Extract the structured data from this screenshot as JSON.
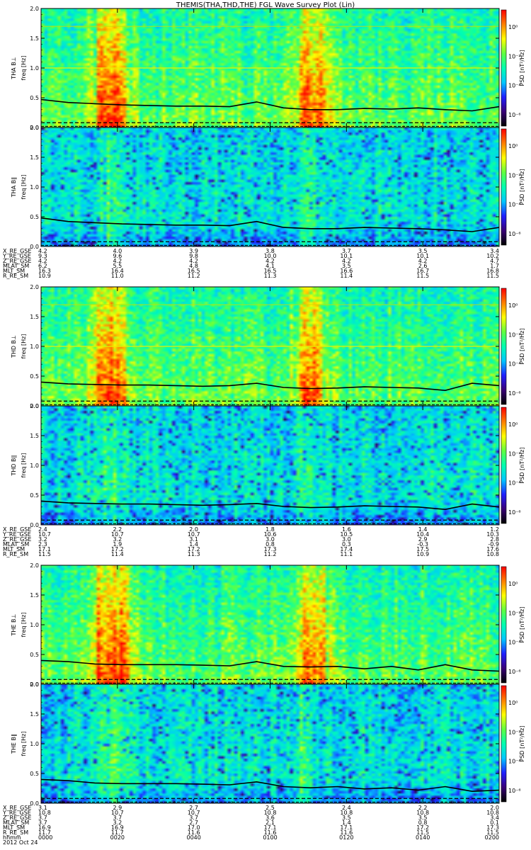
{
  "chart_data": {
    "type": "heatmap",
    "title": "THEMIS(THA,THD,THE) FGL Wave Survey Plot (Lin)",
    "frequency_range": [
      0,
      2.0
    ],
    "yticks": [
      "2.0",
      "1.5",
      "1.0",
      "0.5",
      "0.0"
    ],
    "colorbar_label": "PSD [nT²/Hz]",
    "colorbar_ticks": [
      "10⁰",
      "10⁻²",
      "10⁻⁴",
      "10⁻⁶"
    ],
    "colorscale": [
      "#000000",
      "#3a0078",
      "#2020ff",
      "#00c8ff",
      "#00ffb0",
      "#60ff40",
      "#ffff00",
      "#ff8000",
      "#ff0000"
    ],
    "panels": [
      {
        "probe": "THA",
        "sub": [
          {
            "label": "THA B⊥",
            "ylabel": "freq [Hz]",
            "kind": "perp",
            "vbands": [
              [
                0.12,
                0.18,
                0.95
              ],
              [
                0.56,
                0.62,
                0.95
              ]
            ],
            "hline": 1.0,
            "hline2": 1.7,
            "line": [
              0.47,
              0.42,
              0.4,
              0.38,
              0.37,
              0.36,
              0.36,
              0.35,
              0.43,
              0.33,
              0.3,
              0.3,
              0.32,
              0.31,
              0.33,
              0.3,
              0.28,
              0.35
            ]
          },
          {
            "label": "THA B∥",
            "ylabel": "freq [Hz]",
            "kind": "par",
            "vbands": [
              [
                0.14,
                0.17,
                0.55
              ],
              [
                0.56,
                0.58,
                0.5
              ]
            ],
            "line": [
              0.48,
              0.42,
              0.4,
              0.38,
              0.37,
              0.36,
              0.36,
              0.35,
              0.42,
              0.32,
              0.3,
              0.3,
              0.32,
              0.31,
              0.3,
              0.28,
              0.25,
              0.32
            ]
          }
        ],
        "ephem_labels": [
          "X_RE_GSE",
          "Y_RE_GSE",
          "Z_RE_GSE",
          "MLAT_SM",
          "MLT_SM",
          "R_RE_SM"
        ],
        "ephem": [
          [
            "4.2",
            "4.0",
            "3.9",
            "3.8",
            "3.7",
            "3.5",
            "3.4"
          ],
          [
            "9.3",
            "9.6",
            "9.8",
            "10.0",
            "10.1",
            "10.1",
            "10.2"
          ],
          [
            "4.2",
            "4.2",
            "4.2",
            "4.2",
            "4.2",
            "4.2",
            "4.7"
          ],
          [
            "6.2",
            "5.5",
            "4.8",
            "4.1",
            "3.5",
            "2.6",
            "1.7"
          ],
          [
            "16.3",
            "16.4",
            "16.5",
            "16.5",
            "16.6",
            "16.7",
            "16.8"
          ],
          [
            "10.9",
            "11.0",
            "11.2",
            "11.3",
            "11.4",
            "11.5",
            "11.5"
          ]
        ]
      },
      {
        "probe": "THD",
        "sub": [
          {
            "label": "THD B⊥",
            "ylabel": "freq [Hz]",
            "kind": "perp",
            "vbands": [
              [
                0.12,
                0.18,
                0.95
              ],
              [
                0.56,
                0.61,
                0.85
              ]
            ],
            "hline": 1.0,
            "hline2": 1.7,
            "line": [
              0.4,
              0.37,
              0.36,
              0.35,
              0.35,
              0.34,
              0.33,
              0.34,
              0.38,
              0.31,
              0.29,
              0.3,
              0.32,
              0.31,
              0.3,
              0.26,
              0.38,
              0.34
            ]
          },
          {
            "label": "THD B∥",
            "ylabel": "freq [Hz]",
            "kind": "par",
            "vbands": [
              [
                0.13,
                0.16,
                0.45
              ],
              [
                0.57,
                0.59,
                0.45
              ]
            ],
            "line": [
              0.4,
              0.37,
              0.36,
              0.35,
              0.35,
              0.34,
              0.33,
              0.34,
              0.36,
              0.31,
              0.29,
              0.3,
              0.32,
              0.31,
              0.3,
              0.26,
              0.35,
              0.3
            ]
          }
        ],
        "ephem_labels": [
          "X_RE_GSE",
          "Y_RE_GSE",
          "Z_RE_GSE",
          "MLAT_SM",
          "MLT_SM",
          "R_RE_SM"
        ],
        "ephem": [
          [
            "2.4",
            "2.2",
            "2.0",
            "1.8",
            "1.6",
            "1.4",
            "1.2"
          ],
          [
            "10.7",
            "10.7",
            "10.7",
            "10.6",
            "10.5",
            "10.4",
            "10.3"
          ],
          [
            "3.2",
            "3.2",
            "3.1",
            "3.0",
            "3.0",
            "2.9",
            "2.8"
          ],
          [
            "2.3",
            "1.9",
            "1.4",
            "0.8",
            "0.3",
            "-0.3",
            "-0.9"
          ],
          [
            "17.1",
            "17.2",
            "17.2",
            "17.3",
            "17.4",
            "17.5",
            "17.6"
          ],
          [
            "11.5",
            "11.4",
            "11.3",
            "11.2",
            "11.1",
            "10.9",
            "10.8"
          ]
        ]
      },
      {
        "probe": "THE",
        "sub": [
          {
            "label": "THE B⊥",
            "ylabel": "freq [Hz]",
            "kind": "perp",
            "vbands": [
              [
                0.12,
                0.19,
                1.0
              ],
              [
                0.56,
                0.62,
                0.8
              ]
            ],
            "line": [
              0.4,
              0.38,
              0.34,
              0.33,
              0.33,
              0.33,
              0.32,
              0.31,
              0.38,
              0.3,
              0.29,
              0.3,
              0.26,
              0.3,
              0.24,
              0.33,
              0.24,
              0.22
            ]
          },
          {
            "label": "THE B∥",
            "ylabel": "freq [Hz]",
            "kind": "par",
            "vbands": [
              [
                0.13,
                0.17,
                0.5
              ],
              [
                0.56,
                0.58,
                0.45
              ]
            ],
            "line": [
              0.4,
              0.38,
              0.34,
              0.33,
              0.33,
              0.33,
              0.32,
              0.31,
              0.36,
              0.28,
              0.26,
              0.28,
              0.24,
              0.26,
              0.22,
              0.28,
              0.2,
              0.22
            ]
          }
        ],
        "ephem_labels": [
          "X_RE_GSE",
          "Y_RE_GSE",
          "Z_RE_GSE",
          "MLAT_SM",
          "MLT_SM",
          "R_RE_SM",
          "hhmm"
        ],
        "ephem": [
          [
            "3.1",
            "2.9",
            "2.7",
            "2.5",
            "2.4",
            "2.2",
            "2.0"
          ],
          [
            "10.8",
            "10.7",
            "10.7",
            "10.8",
            "10.8",
            "10.8",
            "10.8"
          ],
          [
            "3.7",
            "3.7",
            "3.7",
            "3.6",
            "3.5",
            "3.5",
            "3.4"
          ],
          [
            "3.7",
            "3.2",
            "2.7",
            "2.1",
            "1.4",
            "0.8",
            "0.1"
          ],
          [
            "16.9",
            "16.9",
            "17.0",
            "17.1",
            "17.1",
            "17.2",
            "17.3"
          ],
          [
            "11.7",
            "11.7",
            "11.6",
            "11.6",
            "11.6",
            "11.5",
            "11.5"
          ],
          [
            "0000",
            "0020",
            "0040",
            "0100",
            "0120",
            "0140",
            "0200"
          ]
        ]
      }
    ],
    "date": "2012 Oct 24"
  }
}
